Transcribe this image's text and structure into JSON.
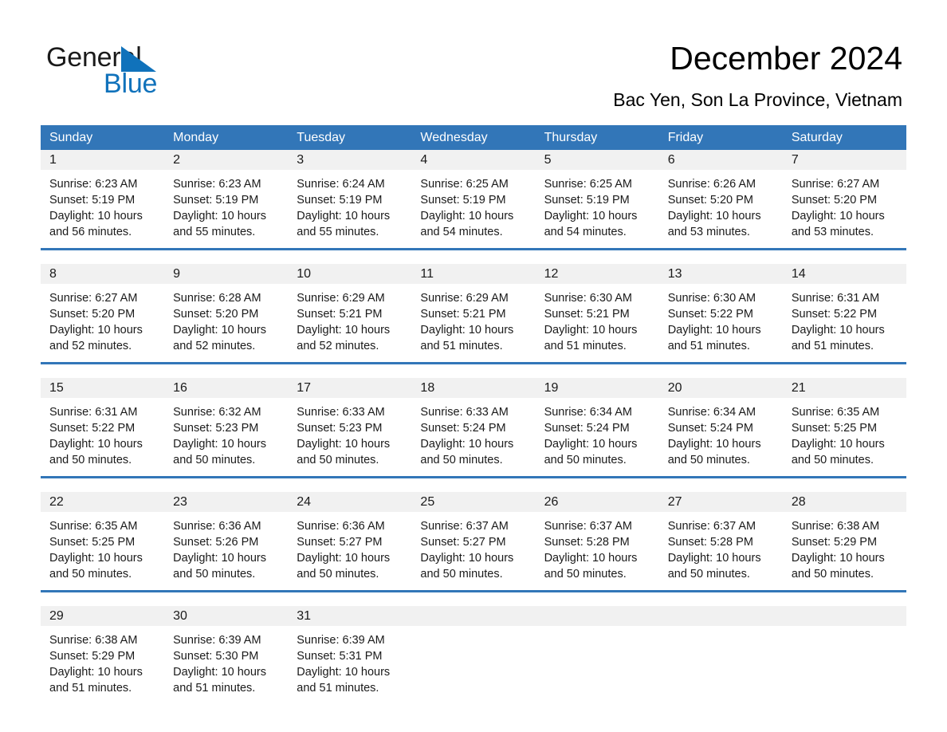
{
  "brand": {
    "name_part1": "General",
    "name_part2": "Blue",
    "triangle_color": "#1072bb",
    "text_color": "#1a1a1a"
  },
  "header": {
    "title": "December 2024",
    "subtitle": "Bac Yen, Son La Province, Vietnam"
  },
  "theme": {
    "header_blue": "#3276b8",
    "daynum_band": "#f1f1f1",
    "page_background": "#ffffff"
  },
  "calendar": {
    "weekdays": [
      "Sunday",
      "Monday",
      "Tuesday",
      "Wednesday",
      "Thursday",
      "Friday",
      "Saturday"
    ],
    "weeks": [
      [
        {
          "day": "1",
          "sunrise": "Sunrise: 6:23 AM",
          "sunset": "Sunset: 5:19 PM",
          "daylight": "Daylight: 10 hours and 56 minutes."
        },
        {
          "day": "2",
          "sunrise": "Sunrise: 6:23 AM",
          "sunset": "Sunset: 5:19 PM",
          "daylight": "Daylight: 10 hours and 55 minutes."
        },
        {
          "day": "3",
          "sunrise": "Sunrise: 6:24 AM",
          "sunset": "Sunset: 5:19 PM",
          "daylight": "Daylight: 10 hours and 55 minutes."
        },
        {
          "day": "4",
          "sunrise": "Sunrise: 6:25 AM",
          "sunset": "Sunset: 5:19 PM",
          "daylight": "Daylight: 10 hours and 54 minutes."
        },
        {
          "day": "5",
          "sunrise": "Sunrise: 6:25 AM",
          "sunset": "Sunset: 5:19 PM",
          "daylight": "Daylight: 10 hours and 54 minutes."
        },
        {
          "day": "6",
          "sunrise": "Sunrise: 6:26 AM",
          "sunset": "Sunset: 5:20 PM",
          "daylight": "Daylight: 10 hours and 53 minutes."
        },
        {
          "day": "7",
          "sunrise": "Sunrise: 6:27 AM",
          "sunset": "Sunset: 5:20 PM",
          "daylight": "Daylight: 10 hours and 53 minutes."
        }
      ],
      [
        {
          "day": "8",
          "sunrise": "Sunrise: 6:27 AM",
          "sunset": "Sunset: 5:20 PM",
          "daylight": "Daylight: 10 hours and 52 minutes."
        },
        {
          "day": "9",
          "sunrise": "Sunrise: 6:28 AM",
          "sunset": "Sunset: 5:20 PM",
          "daylight": "Daylight: 10 hours and 52 minutes."
        },
        {
          "day": "10",
          "sunrise": "Sunrise: 6:29 AM",
          "sunset": "Sunset: 5:21 PM",
          "daylight": "Daylight: 10 hours and 52 minutes."
        },
        {
          "day": "11",
          "sunrise": "Sunrise: 6:29 AM",
          "sunset": "Sunset: 5:21 PM",
          "daylight": "Daylight: 10 hours and 51 minutes."
        },
        {
          "day": "12",
          "sunrise": "Sunrise: 6:30 AM",
          "sunset": "Sunset: 5:21 PM",
          "daylight": "Daylight: 10 hours and 51 minutes."
        },
        {
          "day": "13",
          "sunrise": "Sunrise: 6:30 AM",
          "sunset": "Sunset: 5:22 PM",
          "daylight": "Daylight: 10 hours and 51 minutes."
        },
        {
          "day": "14",
          "sunrise": "Sunrise: 6:31 AM",
          "sunset": "Sunset: 5:22 PM",
          "daylight": "Daylight: 10 hours and 51 minutes."
        }
      ],
      [
        {
          "day": "15",
          "sunrise": "Sunrise: 6:31 AM",
          "sunset": "Sunset: 5:22 PM",
          "daylight": "Daylight: 10 hours and 50 minutes."
        },
        {
          "day": "16",
          "sunrise": "Sunrise: 6:32 AM",
          "sunset": "Sunset: 5:23 PM",
          "daylight": "Daylight: 10 hours and 50 minutes."
        },
        {
          "day": "17",
          "sunrise": "Sunrise: 6:33 AM",
          "sunset": "Sunset: 5:23 PM",
          "daylight": "Daylight: 10 hours and 50 minutes."
        },
        {
          "day": "18",
          "sunrise": "Sunrise: 6:33 AM",
          "sunset": "Sunset: 5:24 PM",
          "daylight": "Daylight: 10 hours and 50 minutes."
        },
        {
          "day": "19",
          "sunrise": "Sunrise: 6:34 AM",
          "sunset": "Sunset: 5:24 PM",
          "daylight": "Daylight: 10 hours and 50 minutes."
        },
        {
          "day": "20",
          "sunrise": "Sunrise: 6:34 AM",
          "sunset": "Sunset: 5:24 PM",
          "daylight": "Daylight: 10 hours and 50 minutes."
        },
        {
          "day": "21",
          "sunrise": "Sunrise: 6:35 AM",
          "sunset": "Sunset: 5:25 PM",
          "daylight": "Daylight: 10 hours and 50 minutes."
        }
      ],
      [
        {
          "day": "22",
          "sunrise": "Sunrise: 6:35 AM",
          "sunset": "Sunset: 5:25 PM",
          "daylight": "Daylight: 10 hours and 50 minutes."
        },
        {
          "day": "23",
          "sunrise": "Sunrise: 6:36 AM",
          "sunset": "Sunset: 5:26 PM",
          "daylight": "Daylight: 10 hours and 50 minutes."
        },
        {
          "day": "24",
          "sunrise": "Sunrise: 6:36 AM",
          "sunset": "Sunset: 5:27 PM",
          "daylight": "Daylight: 10 hours and 50 minutes."
        },
        {
          "day": "25",
          "sunrise": "Sunrise: 6:37 AM",
          "sunset": "Sunset: 5:27 PM",
          "daylight": "Daylight: 10 hours and 50 minutes."
        },
        {
          "day": "26",
          "sunrise": "Sunrise: 6:37 AM",
          "sunset": "Sunset: 5:28 PM",
          "daylight": "Daylight: 10 hours and 50 minutes."
        },
        {
          "day": "27",
          "sunrise": "Sunrise: 6:37 AM",
          "sunset": "Sunset: 5:28 PM",
          "daylight": "Daylight: 10 hours and 50 minutes."
        },
        {
          "day": "28",
          "sunrise": "Sunrise: 6:38 AM",
          "sunset": "Sunset: 5:29 PM",
          "daylight": "Daylight: 10 hours and 50 minutes."
        }
      ],
      [
        {
          "day": "29",
          "sunrise": "Sunrise: 6:38 AM",
          "sunset": "Sunset: 5:29 PM",
          "daylight": "Daylight: 10 hours and 51 minutes."
        },
        {
          "day": "30",
          "sunrise": "Sunrise: 6:39 AM",
          "sunset": "Sunset: 5:30 PM",
          "daylight": "Daylight: 10 hours and 51 minutes."
        },
        {
          "day": "31",
          "sunrise": "Sunrise: 6:39 AM",
          "sunset": "Sunset: 5:31 PM",
          "daylight": "Daylight: 10 hours and 51 minutes."
        },
        null,
        null,
        null,
        null
      ]
    ]
  }
}
